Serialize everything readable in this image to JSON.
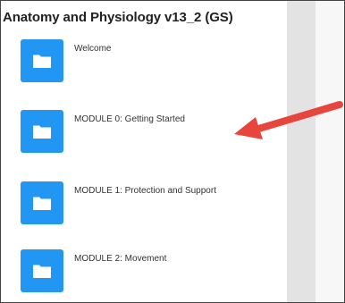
{
  "course": {
    "title": "Anatomy and Physiology v13_2 (GS)"
  },
  "items": [
    {
      "label": "Welcome",
      "icon": "folder-icon"
    },
    {
      "label": "MODULE 0: Getting Started",
      "icon": "folder-icon"
    },
    {
      "label": "MODULE 1: Protection and Support",
      "icon": "folder-icon"
    },
    {
      "label": "MODULE 2: Movement",
      "icon": "folder-icon"
    }
  ],
  "colors": {
    "folder_tile": "#2196f3",
    "annotation_arrow": "#e8453c"
  }
}
